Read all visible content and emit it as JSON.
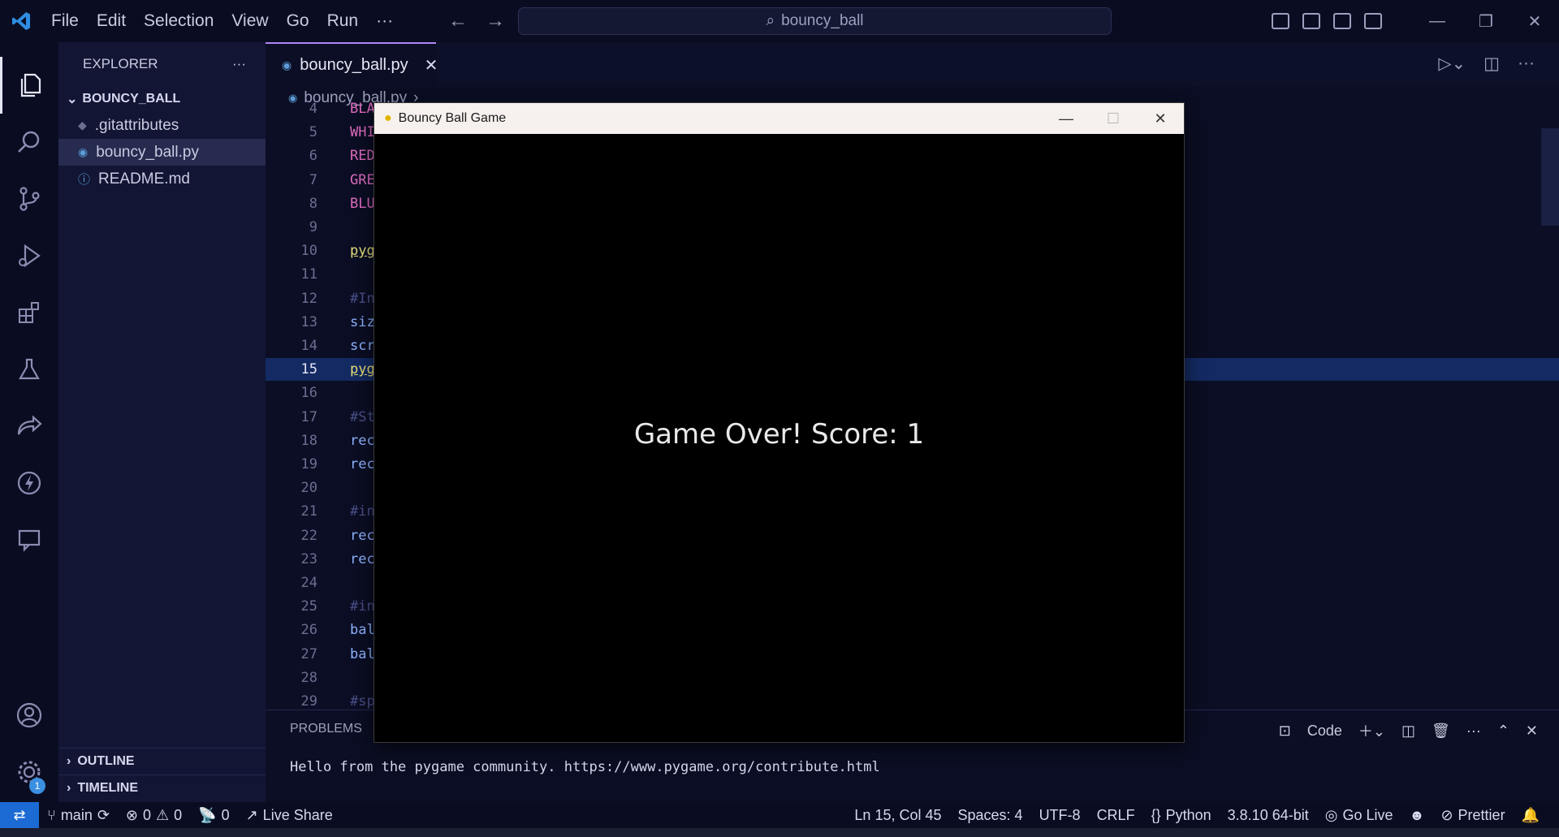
{
  "titlebar": {
    "menu": [
      "File",
      "Edit",
      "Selection",
      "View",
      "Go",
      "Run",
      "···"
    ],
    "command_center": "bouncy_ball"
  },
  "sidebar": {
    "title": "EXPLORER",
    "more": "···",
    "root": "BOUNCY_BALL",
    "files": [
      ".gitattributes",
      "bouncy_ball.py",
      "README.md"
    ],
    "outline": "OUTLINE",
    "timeline": "TIMELINE"
  },
  "activity": {
    "settings_badge": "1"
  },
  "tab": {
    "label": "bouncy_ball.py"
  },
  "breadcrumb": {
    "file": "bouncy_ball.py",
    "sep": "›"
  },
  "code_lines": [
    {
      "n": "4",
      "t": "BLA",
      "c": "#e06cc0"
    },
    {
      "n": "5",
      "t": "WHI",
      "c": "#e06cc0"
    },
    {
      "n": "6",
      "t": "RED",
      "c": "#e06cc0"
    },
    {
      "n": "7",
      "t": "GRE",
      "c": "#e06cc0"
    },
    {
      "n": "8",
      "t": "BLU",
      "c": "#e06cc0"
    },
    {
      "n": "9",
      "t": "",
      "c": "#c5c8e0"
    },
    {
      "n": "10",
      "t": "pyg",
      "c": "#e8e07a"
    },
    {
      "n": "11",
      "t": "",
      "c": "#c5c8e0"
    },
    {
      "n": "12",
      "t": "#In",
      "c": "#4a5189"
    },
    {
      "n": "13",
      "t": "siz",
      "c": "#8fb4ff"
    },
    {
      "n": "14",
      "t": "scr",
      "c": "#8fb4ff"
    },
    {
      "n": "15",
      "t": "pyg",
      "c": "#e8e07a"
    },
    {
      "n": "16",
      "t": "",
      "c": "#c5c8e0"
    },
    {
      "n": "17",
      "t": "#St",
      "c": "#4a5189"
    },
    {
      "n": "18",
      "t": "rec",
      "c": "#8fb4ff"
    },
    {
      "n": "19",
      "t": "rec",
      "c": "#8fb4ff"
    },
    {
      "n": "20",
      "t": "",
      "c": "#c5c8e0"
    },
    {
      "n": "21",
      "t": "#in",
      "c": "#4a5189"
    },
    {
      "n": "22",
      "t": "rec",
      "c": "#8fb4ff"
    },
    {
      "n": "23",
      "t": "rec",
      "c": "#8fb4ff"
    },
    {
      "n": "24",
      "t": "",
      "c": "#c5c8e0"
    },
    {
      "n": "25",
      "t": "#in",
      "c": "#4a5189"
    },
    {
      "n": "26",
      "t": "bal",
      "c": "#8fb4ff"
    },
    {
      "n": "27",
      "t": "bal",
      "c": "#8fb4ff"
    },
    {
      "n": "28",
      "t": "",
      "c": "#c5c8e0"
    },
    {
      "n": "29",
      "t": "#sp",
      "c": "#4a5189"
    }
  ],
  "current_line": "15",
  "panel": {
    "tab": "PROBLEMS",
    "terminal_label": "Code",
    "output": "Hello from the pygame community. https://www.pygame.org/contribute.html"
  },
  "statusbar": {
    "branch": "main",
    "errors": "0",
    "warnings": "0",
    "ports": "0",
    "live_share": "Live Share",
    "position": "Ln 15, Col 45",
    "spaces": "Spaces: 4",
    "encoding": "UTF-8",
    "eol": "CRLF",
    "language": "Python",
    "interpreter": "3.8.10 64-bit",
    "go_live": "Go Live",
    "prettier": "Prettier"
  },
  "game_window": {
    "title": "Bouncy Ball Game",
    "message": "Game Over! Score: 1"
  }
}
